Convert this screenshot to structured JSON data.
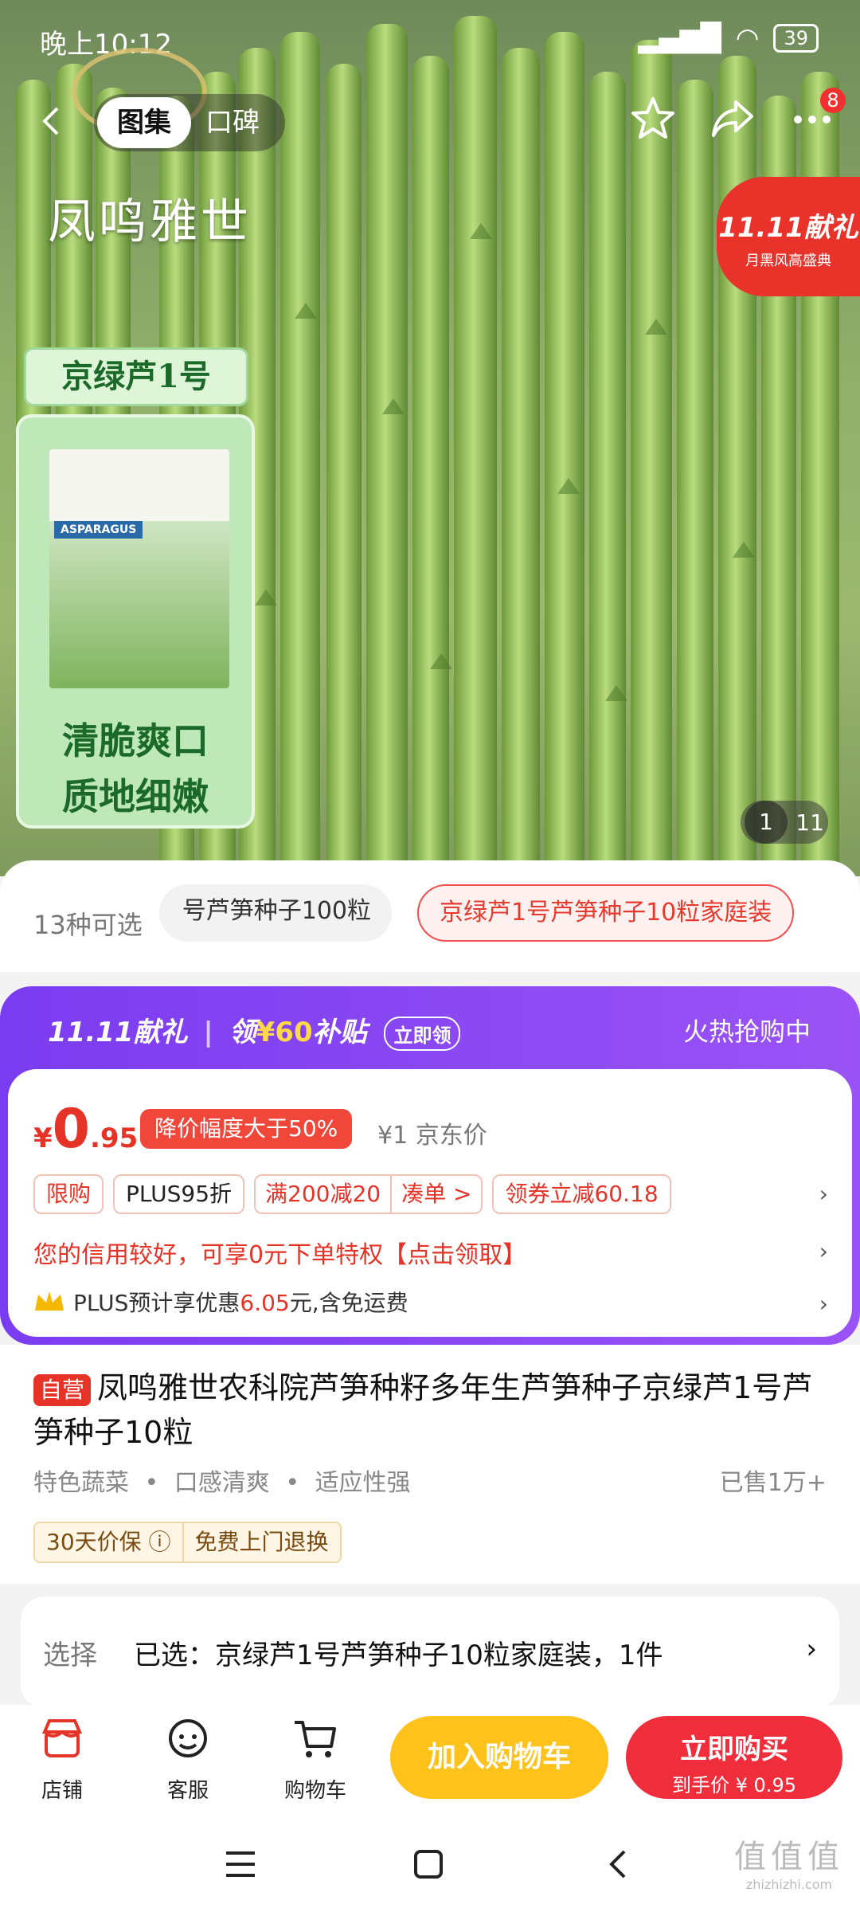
{
  "status": {
    "time": "晚上10:12",
    "battery": "39"
  },
  "nav": {
    "tab_active": "图集",
    "tab_inactive": "口碑",
    "cart_badge": "8"
  },
  "hero": {
    "brand": "凤鸣雅世",
    "promo_title": "11.11献礼",
    "promo_sub": "月黑风高盛典",
    "variety_tag": "京绿芦1号",
    "packet_label": "ASPARAGUS",
    "slogan_1": "清脆爽口",
    "slogan_2": "质地细嫩",
    "image_current": "1",
    "image_total": "11"
  },
  "variants": {
    "count_text": "13种可选",
    "option_a": "号芦笋种子100粒",
    "option_b": "京绿芦1号芦笋种子10粒家庭装"
  },
  "promo": {
    "event": "11.11献礼",
    "subsidy_pre": "领",
    "subsidy_amount": "¥60",
    "subsidy_post": "补贴",
    "claim": "立即领",
    "hot": "火热抢购中"
  },
  "price": {
    "currency": "¥",
    "integer": "0",
    "decimal": ".95",
    "drop_badge": "降价幅度大于50%",
    "jd_price": "¥1 京东价",
    "tags": {
      "limit": "限购",
      "plus": "PLUS95折",
      "full": "满200减20",
      "combine": "凑单 >",
      "coupon": "领券立减60.18"
    },
    "credit": "您的信用较好，可享0元下单特权【点击领取】",
    "plus_pre": "PLUS预计享优惠",
    "plus_amt": "6.05",
    "plus_post": "元,含免运费"
  },
  "product": {
    "self_tag": "自营",
    "title": "凤鸣雅世农科院芦笋种籽多年生芦笋种子京绿芦1号芦笋种子10粒",
    "feature_1": "特色蔬菜",
    "feature_2": "口感清爽",
    "feature_3": "适应性强",
    "sold": "已售1万+",
    "guarantee_1": "30天价保 ⓘ",
    "guarantee_2": "免费上门退换"
  },
  "select": {
    "key": "选择",
    "value": "已选：京绿芦1号芦笋种子10粒家庭装，1件",
    "chevron": "›"
  },
  "bottom": {
    "store": "店铺",
    "service": "客服",
    "cart": "购物车",
    "add_cart": "加入购物车",
    "buy_now": "立即购买",
    "buy_sub": "到手价 ¥ 0.95"
  },
  "watermark": {
    "big": "值值值",
    "small": "zhizhizhi.com"
  },
  "colors": {
    "accent_red": "#e53327",
    "purple": "#7a3cf0",
    "cart_yellow": "#ffc21a",
    "buy_red": "#ef2d3b"
  }
}
